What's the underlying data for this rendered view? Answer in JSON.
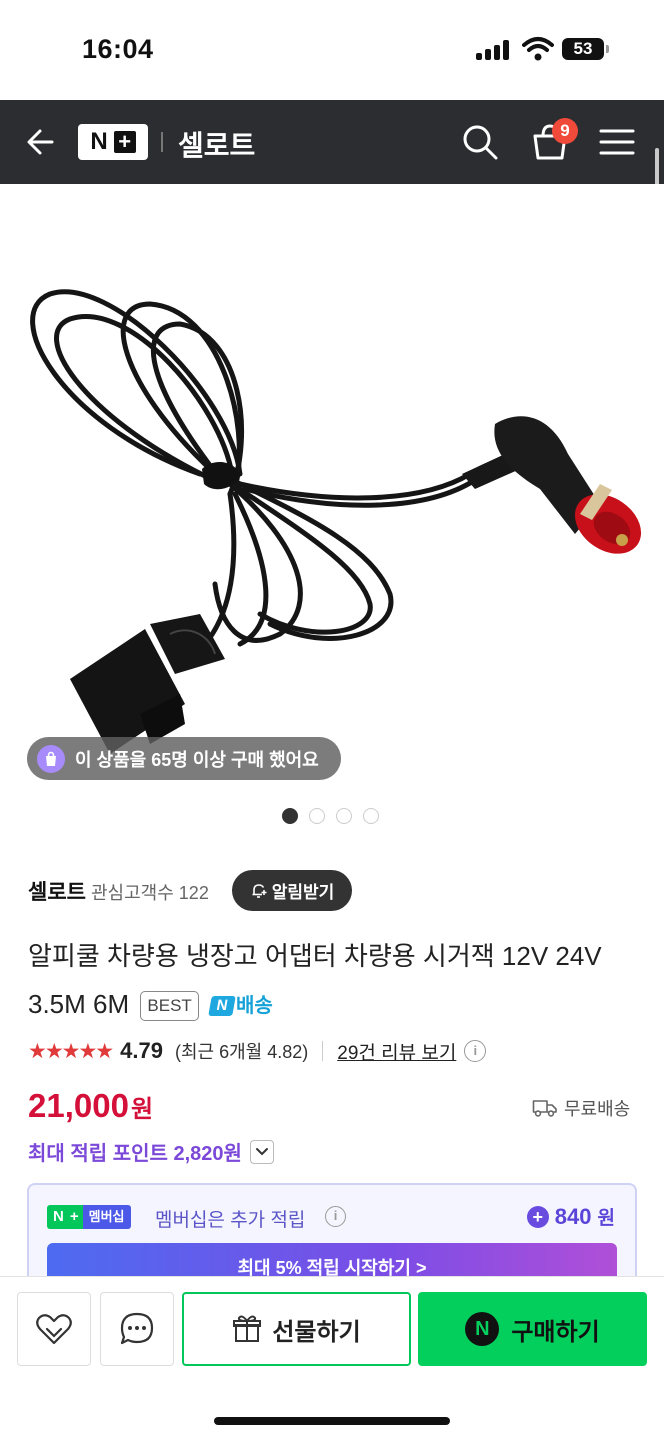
{
  "status": {
    "time": "16:04",
    "battery": "53"
  },
  "nav": {
    "title": "셀로트",
    "logo_n": "N",
    "logo_plus": "+",
    "cart_count": "9"
  },
  "image": {
    "purchase_notice": "이 상품을 65명 이상 구매 했어요",
    "page_count": 4,
    "current_page": 1
  },
  "store": {
    "name": "셀로트",
    "followers": "관심고객수 122",
    "alarm_label": "알림받기"
  },
  "product": {
    "title": "알피쿨 차량용 냉장고 어댑터 차량용 시거잭 12V 24V 3.5M 6M",
    "best_badge": "BEST",
    "delivery_badge_n": "N",
    "delivery_badge": "배송"
  },
  "rating": {
    "stars": "★★★★★",
    "value": "4.79",
    "recent": "(최근 6개월 4.82)",
    "review_link": "29건 리뷰 보기"
  },
  "price": {
    "amount": "21,000",
    "unit": "원",
    "shipping": "무료배송"
  },
  "points": {
    "label": "최대 적립 포인트 2,820원"
  },
  "membership": {
    "badge_n": "N",
    "badge_plus": "+",
    "badge_label": "멤버십",
    "text": "멤버십은 추가 적립",
    "points": "840",
    "points_unit": "원",
    "cta": "최대 5% 적립 시작하기 >"
  },
  "actions": {
    "gift": "선물하기",
    "buy": "구매하기",
    "buy_n": "N"
  },
  "colors": {
    "nav_bg": "#2b2d31",
    "price": "#d40f3a",
    "points": "#7b48d8",
    "naver_green": "#03c75a",
    "stars": "#e13a3a"
  }
}
